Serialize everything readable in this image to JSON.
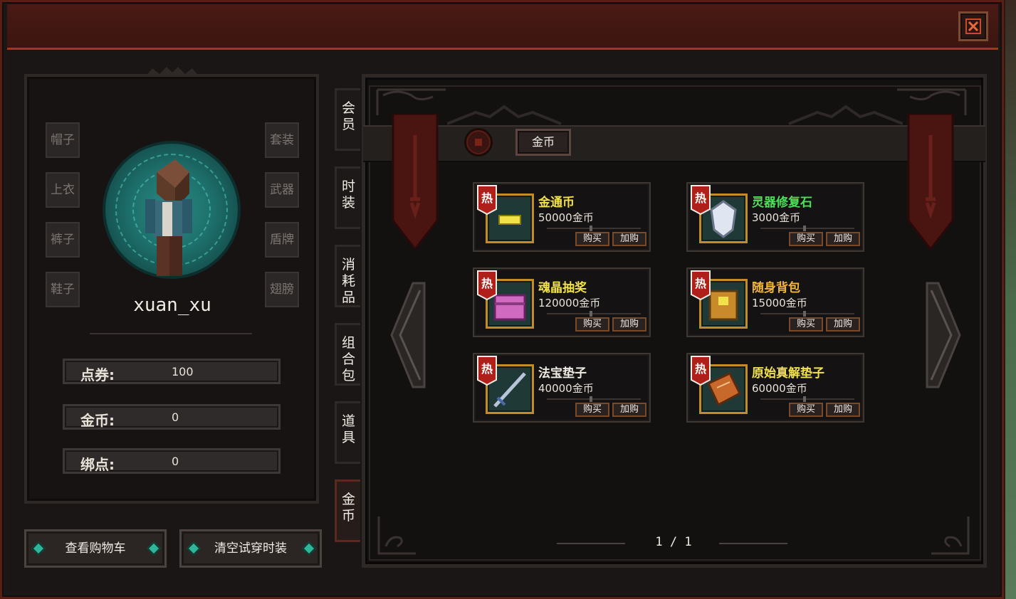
{
  "profile": {
    "username": "xuan_xu",
    "slots_left": [
      "帽子",
      "上衣",
      "裤子",
      "鞋子"
    ],
    "slots_right": [
      "套装",
      "武器",
      "盾牌",
      "翅膀"
    ],
    "stats": [
      {
        "label": "点券:",
        "value": "100"
      },
      {
        "label": "金币:",
        "value": "0"
      },
      {
        "label": "绑点:",
        "value": "0"
      }
    ],
    "buttons": {
      "view_cart": "查看购物车",
      "clear_tryon": "清空试穿时装"
    }
  },
  "categories": [
    {
      "label": "会\n员"
    },
    {
      "label": "时\n装"
    },
    {
      "label": "消\n耗\n品"
    },
    {
      "label": "组\n合\n包"
    },
    {
      "label": "道\n具"
    },
    {
      "label": "金\n币"
    }
  ],
  "active_category": "金币",
  "filter": {
    "tab": "金币"
  },
  "items": [
    {
      "badge": "热",
      "name": "金通币",
      "price": "50000金币",
      "name_color": "#f2e24a",
      "icon": "gold-bar-icon",
      "buy": "购买",
      "add": "加购"
    },
    {
      "badge": "热",
      "name": "灵器修复石",
      "price": "3000金币",
      "name_color": "#4ce05a",
      "icon": "crystal-icon",
      "buy": "购买",
      "add": "加购"
    },
    {
      "badge": "热",
      "name": "魂晶抽奖",
      "price": "120000金币",
      "name_color": "#f2e24a",
      "icon": "treasure-chest-icon",
      "buy": "购买",
      "add": "加购"
    },
    {
      "badge": "热",
      "name": "随身背包",
      "price": "15000金币",
      "name_color": "#f2b63a",
      "icon": "backpack-icon",
      "buy": "购买",
      "add": "加购"
    },
    {
      "badge": "热",
      "name": "法宝垫子",
      "price": "40000金币",
      "name_color": "#f0ece4",
      "icon": "sword-icon",
      "buy": "购买",
      "add": "加购"
    },
    {
      "badge": "热",
      "name": "原始真解垫子",
      "price": "60000金币",
      "name_color": "#f2e24a",
      "icon": "book-icon",
      "buy": "购买",
      "add": "加购"
    }
  ],
  "pagination": {
    "text": "1 / 1"
  },
  "colors": {
    "accent": "#a8341e",
    "frame": "#c58a2a",
    "hot_badge": "#b0201a"
  }
}
